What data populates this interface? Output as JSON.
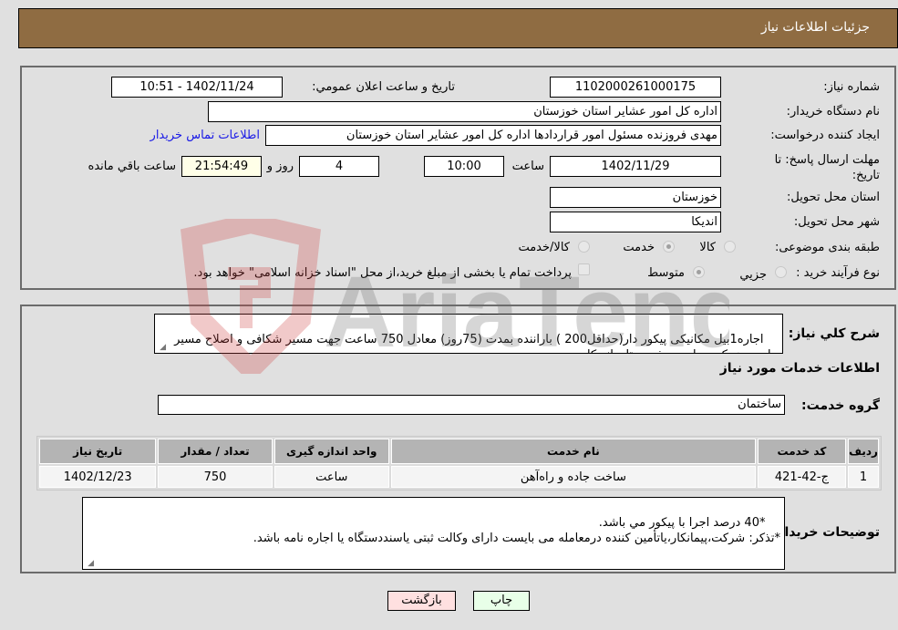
{
  "header": {
    "title": "جزئیات اطلاعات نیاز"
  },
  "details": {
    "need_number_label": "شماره نیاز:",
    "need_number": "1102000261000175",
    "announce_label": "تاریخ و ساعت اعلان عمومي:",
    "announce_value": "1402/11/24 - 10:51",
    "buyer_org_label": "نام دستگاه خریدار:",
    "buyer_org": "اداره کل امور عشایر استان خوزستان",
    "creator_label": "ایجاد کننده درخواست:",
    "creator": "مهدی فروزنده مسئول امور قراردادها اداره کل امور عشایر استان خوزستان",
    "contact_link": "اطلاعات تماس خریدار",
    "deadline_label": "مهلت ارسال پاسخ: تا تاریخ:",
    "deadline_date": "1402/11/29",
    "time_label": "ساعت",
    "deadline_time": "10:00",
    "days_value": "4",
    "days_label": "روز و",
    "remaining_time": "21:54:49",
    "remaining_label": "ساعت باقي مانده",
    "province_label": "استان محل تحویل:",
    "province": "خوزستان",
    "city_label": "شهر محل تحویل:",
    "city": "اندیکا",
    "category_label": "طبقه بندی موضوعی:",
    "category_options": [
      {
        "label": "کالا",
        "selected": false
      },
      {
        "label": "خدمت",
        "selected": true
      },
      {
        "label": "کالا/خدمت",
        "selected": false
      }
    ],
    "process_label": "نوع فرآیند خرید :",
    "process_options": [
      {
        "label": "جزيي",
        "selected": false
      },
      {
        "label": "متوسط",
        "selected": true
      }
    ],
    "treasury_note": "پرداخت تمام یا بخشی از مبلغ خرید،از محل \"اسناد خزانه اسلامی\" خواهد بود.",
    "treasury_checked": false
  },
  "need": {
    "description_label": "شرح کلي نیاز:",
    "description": "اجاره1بیل مکانیکی پیکور دار(حداقل200 ) باراننده بمدت (75روز) معادل 750 ساعت جهت مسیر شکافی و اصلاح مسیر جاده  دهدیک به باورمه شهرستان اندیکا",
    "services_title": "اطلاعات خدمات مورد نیاز",
    "service_group_label": "گروه خدمت:",
    "service_group": "ساختمان",
    "table": {
      "headers": [
        "ردیف",
        "کد خدمت",
        "نام خدمت",
        "واحد اندازه گیری",
        "تعداد / مقدار",
        "تاریخ نیاز"
      ],
      "rows": [
        [
          "1",
          "ج-42-421",
          "ساخت جاده و راه‌آهن",
          "ساعت",
          "750",
          "1402/12/23"
        ]
      ]
    },
    "buyer_notes_label": "توضیحات خریدار:",
    "buyer_notes": "*40 درصد اجرا با پیکور مي باشد.\n*تذکر: شرکت،پیمانکار،یاتأمین کننده درمعامله می بایست دارای وکالت ثبتی یاسنددستگاه یا اجاره نامه باشد."
  },
  "buttons": {
    "print": "چاپ",
    "back": "بازگشت"
  },
  "watermark": {
    "text": "AriaTender.neT"
  }
}
